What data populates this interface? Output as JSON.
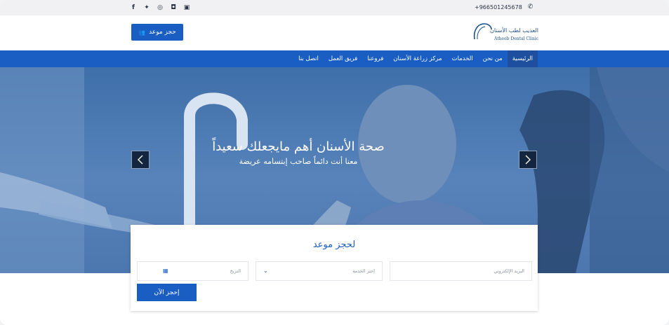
{
  "topbar": {
    "social_icons": [
      {
        "name": "facebook-icon",
        "glyph": "f"
      },
      {
        "name": "twitter-icon",
        "glyph": "✦"
      },
      {
        "name": "instagram-icon",
        "glyph": "◎"
      },
      {
        "name": "snapchat-icon",
        "glyph": "◘"
      },
      {
        "name": "youtube-icon",
        "glyph": "▣"
      }
    ],
    "phone": "+966501245678",
    "phone_icon": "phone-icon"
  },
  "header": {
    "book_button_label": "حجز موعد",
    "logo_ar": "العذيب لطب الأسنان",
    "logo_en": "Atheeb Dental Clinic"
  },
  "nav": {
    "items": [
      {
        "label": "الرئيسية",
        "active": true
      },
      {
        "label": "من نحن"
      },
      {
        "label": "الخدمات"
      },
      {
        "label": "مركز زراعة الأسنان"
      },
      {
        "label": "فروعنا"
      },
      {
        "label": "فريق العمل"
      },
      {
        "label": "اتصل بنا"
      }
    ]
  },
  "hero": {
    "title": "صحة الأسنان أهم مايجعلك سعيداً",
    "subtitle": "معنا أنت دائماً صاحب إبتسامه عريضة",
    "prev_icon": "chevron-left-icon",
    "next_icon": "chevron-right-icon"
  },
  "booking": {
    "title": "لحجز موعد",
    "email_placeholder": "البريد الإلكتروني",
    "service_placeholder": "إختر الخدمة",
    "date_placeholder": "التريخ",
    "submit_label": "إحجز الآن"
  },
  "colors": {
    "primary": "#1a5ec4",
    "nav_active": "#1d4f9e",
    "topbar": "#f1f1f3"
  }
}
